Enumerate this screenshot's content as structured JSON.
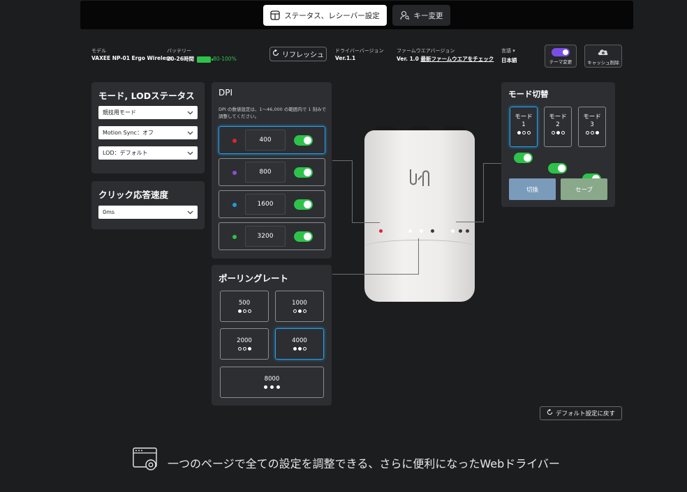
{
  "tabs": [
    {
      "label": "ステータス、レシーバー設定",
      "icon": "dashboard-icon",
      "active": true
    },
    {
      "label": "キー変更",
      "icon": "user-key-icon",
      "active": false
    }
  ],
  "info": {
    "model_label": "モデル",
    "model_value": "VAXEE NP-01 Ergo Wireless",
    "battery_label": "バッテリー",
    "battery_time": "20-26時間",
    "battery_percent": "80-100%",
    "refresh_label": "リフレッシュ",
    "driver_label": "ドライバーバージョン",
    "driver_value": "Ver.1.1",
    "firmware_label": "ファームウエアバージョン",
    "firmware_value": "Ver. 1.0",
    "firmware_link": "最新ファームウエアをチェック",
    "language_label": "言語 ▾",
    "language_value": "日本語",
    "theme_label": "テーマ変更",
    "cache_label": "キャッシュ削除"
  },
  "mode_panel": {
    "title": "モード, LODステータス",
    "selects": [
      "競技用モード",
      "Motion Sync：オフ",
      "LOD：デフォルト"
    ]
  },
  "click_panel": {
    "title": "クリック応答速度",
    "select": "0ms"
  },
  "dpi_panel": {
    "title": "DPI",
    "description": "DPI の数値設定は、1～46,000 の範囲内で 1 刻みで調整してください。",
    "rows": [
      {
        "value": "400",
        "color": "#e0252b",
        "selected": true
      },
      {
        "value": "800",
        "color": "#8a4fd6",
        "selected": false
      },
      {
        "value": "1600",
        "color": "#1f9be0",
        "selected": false
      },
      {
        "value": "3200",
        "color": "#2ec24a",
        "selected": false
      }
    ]
  },
  "polling_panel": {
    "title": "ポーリングレート",
    "options": [
      {
        "value": "500",
        "dots": [
          1,
          0,
          0
        ]
      },
      {
        "value": "1000",
        "dots": [
          0,
          1,
          0
        ]
      },
      {
        "value": "2000",
        "dots": [
          0,
          0,
          1
        ]
      },
      {
        "value": "4000",
        "dots": [
          1,
          1,
          0
        ],
        "selected": true
      },
      {
        "value": "8000",
        "dots": [
          1,
          1,
          1
        ]
      }
    ]
  },
  "switch_panel": {
    "title": "モード切替",
    "modes": [
      {
        "label": "モード",
        "number": "1",
        "dots": [
          1,
          0,
          0
        ],
        "selected": true
      },
      {
        "label": "モード",
        "number": "2",
        "dots": [
          0,
          1,
          0
        ],
        "selected": false
      },
      {
        "label": "モード",
        "number": "3",
        "dots": [
          0,
          0,
          1
        ],
        "selected": false
      }
    ],
    "switch_label": "切換",
    "save_label": "セーブ",
    "switch_color": "#7b9bbb",
    "save_color": "#8aa88a"
  },
  "reset_label": "デフォルト設定に戻す",
  "footer": "一つのページで全ての設定を調整できる、さらに便利になったWebドライバー",
  "colors": {
    "accent": "#2d9de3",
    "toggle_on": "#2ec24a",
    "theme_toggle": "#7a4ee6"
  }
}
